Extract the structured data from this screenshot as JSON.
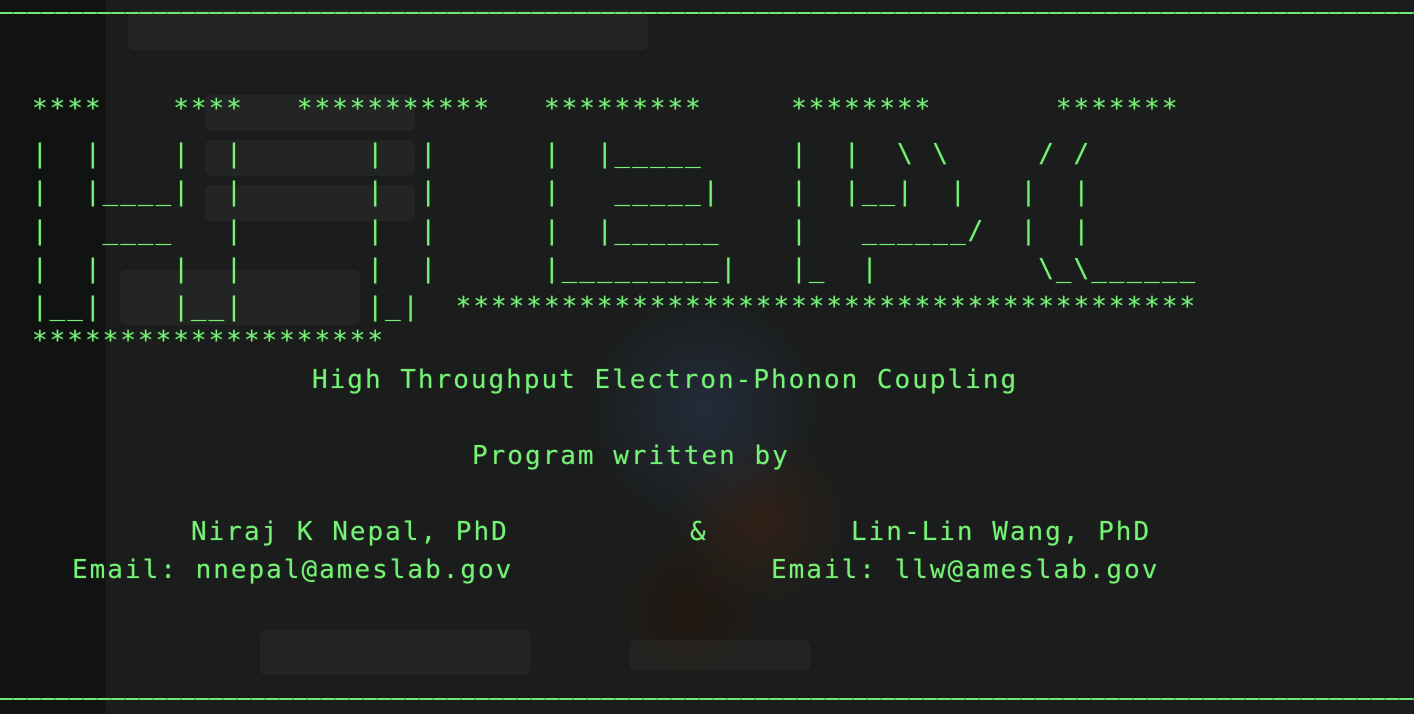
{
  "banner": {
    "lines": [
      "****    ****   ***********   *********     ********       *******",
      "|  |    |  |       |  |      |  |_____     |  |  \\ \\     / /",
      "|  |____|  |       |  |      |   _____|    |  |__|  |   |  |",
      "|   ____   |       |  |      |  |______    |   ______/  |  |",
      "|  |    |  |       |  |      |_________|   |_  |         \\_\\______",
      "|__|    |__|       |_|  ******************************************",
      "********************"
    ]
  },
  "subtitle": "High Throughput Electron-Phonon Coupling",
  "written_by": "Program written by",
  "authors": {
    "left": {
      "name": "Niraj K Nepal, PhD",
      "email": "Email: nnepal@ameslab.gov"
    },
    "amp": "&",
    "right": {
      "name": "Lin-Lin Wang, PhD",
      "email": "Email: llw@ameslab.gov"
    }
  },
  "colors": {
    "text": "#76f276",
    "background": "#121413"
  }
}
